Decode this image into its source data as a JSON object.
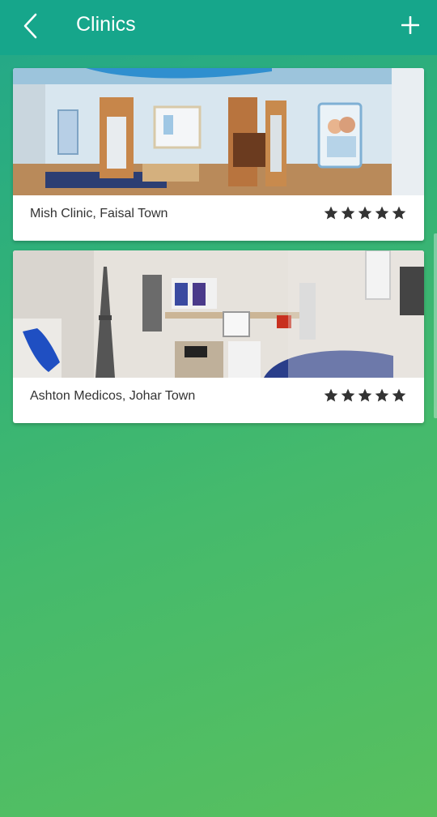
{
  "header": {
    "title": "Clinics",
    "back_icon": "chevron-left-icon",
    "add_icon": "plus-icon"
  },
  "clinics": [
    {
      "name": "Mish Clinic, Faisal Town",
      "rating": 5
    },
    {
      "name": "Ashton Medicos, Johar Town",
      "rating": 5
    }
  ],
  "colors": {
    "appbar": "#16a68b",
    "background_top": "#22a78a",
    "background_bottom": "#58c05e",
    "star": "#333333"
  }
}
